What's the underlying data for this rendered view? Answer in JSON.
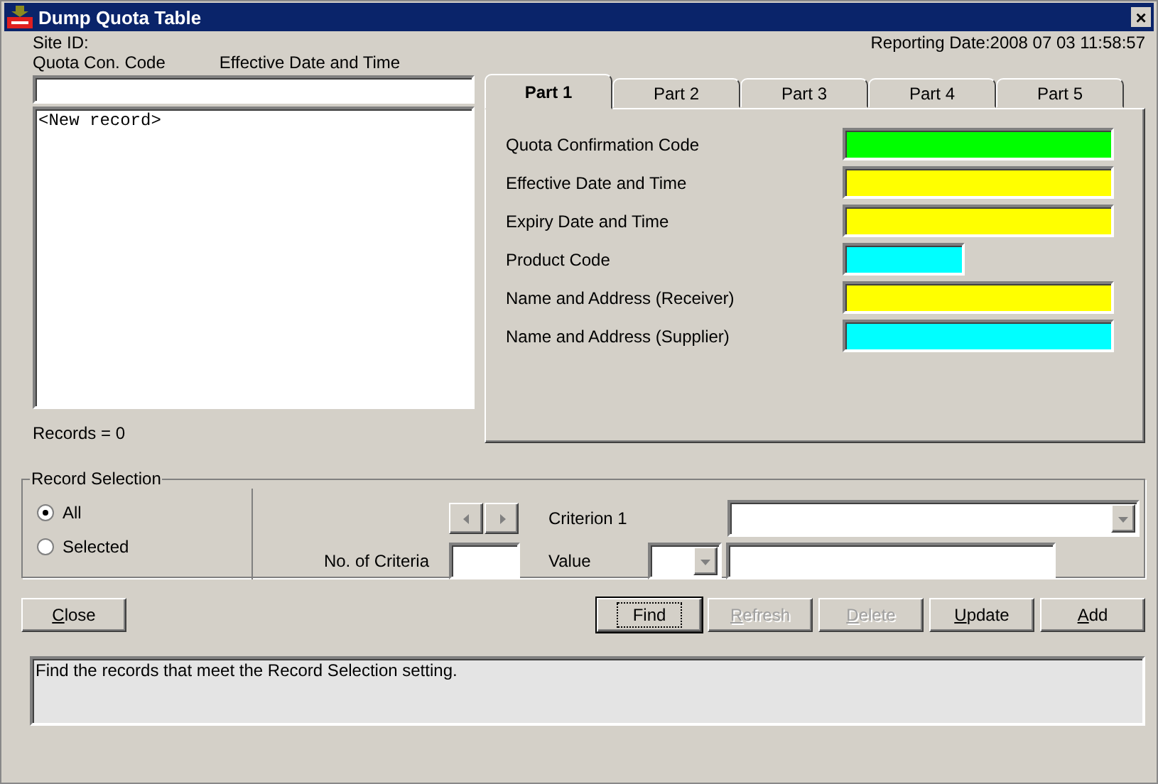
{
  "window": {
    "title": "Dump Quota Table",
    "close": "×"
  },
  "site_label": "Site ID:",
  "reporting_date": "Reporting Date:2008 07 03 11:58:57",
  "list_headers": [
    "Quota Con. Code",
    "Effective Date and Time"
  ],
  "records": [
    "<New record>"
  ],
  "records_count": "Records = 0",
  "tabs": [
    {
      "label": "Part 1",
      "selected": true
    },
    {
      "label": "Part 2",
      "selected": false
    },
    {
      "label": "Part 3",
      "selected": false
    },
    {
      "label": "Part 4",
      "selected": false
    },
    {
      "label": "Part 5",
      "selected": false
    }
  ],
  "fields": [
    {
      "label": "Quota Confirmation Code",
      "color": "#00ff00",
      "kind": "wide"
    },
    {
      "label": "Effective Date and Time",
      "color": "#ffff00",
      "kind": "wide"
    },
    {
      "label": "Expiry Date and Time",
      "color": "#ffff00",
      "kind": "wide"
    },
    {
      "label": "Product Code",
      "color": "#00ffff",
      "kind": "narrow"
    },
    {
      "label": "Name and Address (Receiver)",
      "color": "#ffff00",
      "kind": "wide"
    },
    {
      "label": "Name and Address (Supplier)",
      "color": "#00ffff",
      "kind": "wide"
    }
  ],
  "record_selection": {
    "title": "Record Selection",
    "options": [
      {
        "label": "All",
        "selected": true
      },
      {
        "label": "Selected",
        "selected": false
      }
    ],
    "criteria_label": "No. of Criteria",
    "criterion_label": "Criterion 1",
    "value_label": "Value"
  },
  "buttons": [
    {
      "label": "Close",
      "disabled": false,
      "default": false,
      "underline_first": true
    },
    {
      "label": "Find",
      "disabled": false,
      "default": true,
      "underline_first": false
    },
    {
      "label": "Refresh",
      "disabled": true,
      "default": false,
      "underline_first": true
    },
    {
      "label": "Delete",
      "disabled": true,
      "default": false,
      "underline_first": true
    },
    {
      "label": "Update",
      "disabled": false,
      "default": false,
      "underline_first": true
    },
    {
      "label": "Add",
      "disabled": false,
      "default": false,
      "underline_first": true
    }
  ],
  "status": "Find the records that meet the Record Selection setting."
}
